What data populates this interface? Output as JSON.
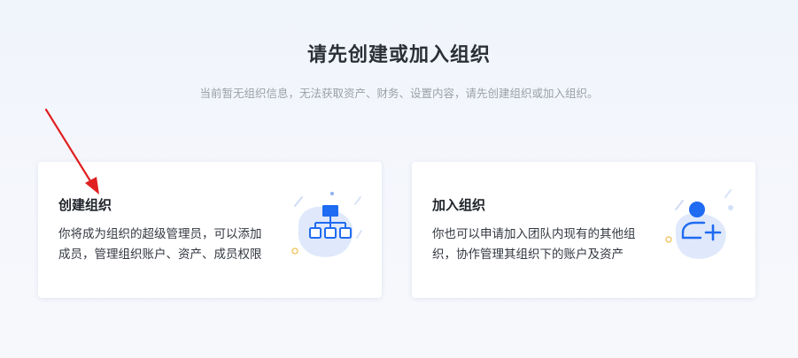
{
  "header": {
    "title": "请先创建或加入组织",
    "subtitle": "当前暂无组织信息，无法获取资产、财务、设置内容，请先创建组织或加入组织。"
  },
  "cards": [
    {
      "title": "创建组织",
      "desc_line1": "你将成为组织的超级管理员，可以添加",
      "desc_line2": "成员，管理组织账户、资产、成员权限",
      "icon": "org-chart-icon"
    },
    {
      "title": "加入组织",
      "desc_line1": "你也可以申请加入团队内现有的其他组",
      "desc_line2": "织，协作管理其组织下的账户及资产",
      "icon": "add-user-icon"
    }
  ],
  "annotation": {
    "arrow_color": "#e02020",
    "points_to": "create-organization-card"
  },
  "colors": {
    "accent": "#1f6bf2",
    "accent_light": "#dfe9fb",
    "decor_yellow": "#f0c25a"
  }
}
